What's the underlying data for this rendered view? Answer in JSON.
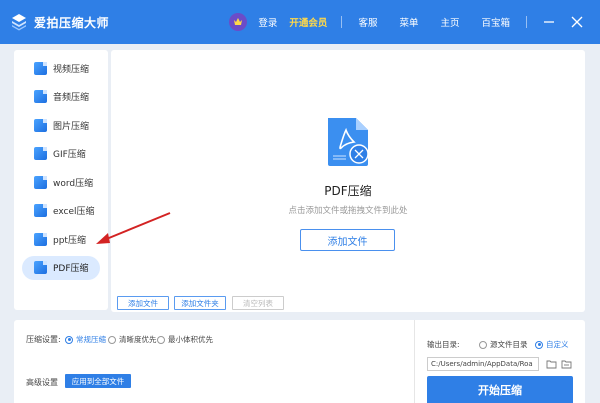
{
  "app": {
    "title": "爱拍压缩大师"
  },
  "header": {
    "login": "登录",
    "vip": "开通会员",
    "service": "客服",
    "menu": "菜单",
    "home": "主页",
    "toolbox": "百宝箱"
  },
  "sidebar": {
    "items": [
      {
        "label": "视频压缩",
        "icon": "video-file-icon"
      },
      {
        "label": "音频压缩",
        "icon": "audio-file-icon"
      },
      {
        "label": "图片压缩",
        "icon": "image-file-icon"
      },
      {
        "label": "GIF压缩",
        "icon": "gif-file-icon"
      },
      {
        "label": "word压缩",
        "icon": "word-file-icon"
      },
      {
        "label": "excel压缩",
        "icon": "excel-file-icon"
      },
      {
        "label": "ppt压缩",
        "icon": "ppt-file-icon"
      },
      {
        "label": "PDF压缩",
        "icon": "pdf-file-icon",
        "active": true
      }
    ]
  },
  "main": {
    "title": "PDF压缩",
    "hint": "点击添加文件或拖拽文件到此处",
    "add_file": "添加文件",
    "buttons": {
      "add_file": "添加文件",
      "add_folder": "添加文件夹",
      "clear_list": "清空列表"
    }
  },
  "settings": {
    "compress_label": "压缩设置:",
    "options": [
      {
        "label": "常规压缩",
        "checked": true
      },
      {
        "label": "清晰度优先",
        "checked": false
      },
      {
        "label": "最小体积优先",
        "checked": false
      }
    ],
    "advanced_label": "高级设置",
    "apply_all": "应用到全部文件"
  },
  "output": {
    "label": "输出目录:",
    "source_dir": "源文件目录",
    "custom": "自定义",
    "path": "C:/Users/admin/AppData/Roa",
    "start": "开始压缩"
  },
  "colors": {
    "brand": "#2f7fe6",
    "vip": "#ffd94a",
    "arrow": "#d32323"
  }
}
